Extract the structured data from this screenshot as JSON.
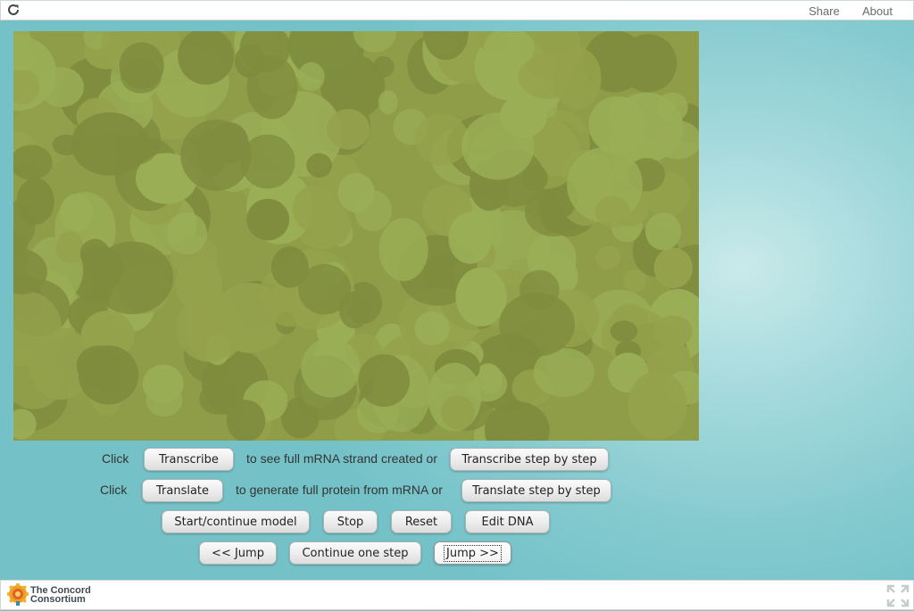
{
  "topbar": {
    "reload_icon": "reload-icon",
    "share_label": "Share",
    "about_label": "About"
  },
  "canvas": {
    "background_color": "#8f9c48",
    "blob_colors": [
      "#7f8c3e",
      "#95a24c",
      "#9aae56"
    ]
  },
  "row1": {
    "click_label": "Click",
    "transcribe_button": "Transcribe",
    "middle_text": "to see full mRNA strand created or",
    "transcribe_step_button": "Transcribe step by step"
  },
  "row2": {
    "click_label": "Click",
    "translate_button": "Translate",
    "middle_text": "to generate full protein from mRNA or",
    "translate_step_button": "Translate step by step"
  },
  "row3": {
    "start_button": "Start/continue model",
    "stop_button": "Stop",
    "reset_button": "Reset",
    "edit_dna_button": "Edit DNA"
  },
  "row4": {
    "jump_back_button": "<< Jump",
    "continue_step_button": "Continue one step",
    "jump_forward_button": "Jump >>"
  },
  "bottombar": {
    "logo_line1": "The Concord",
    "logo_line2": "Consortium",
    "fullscreen_icon": "fullscreen-icon"
  }
}
